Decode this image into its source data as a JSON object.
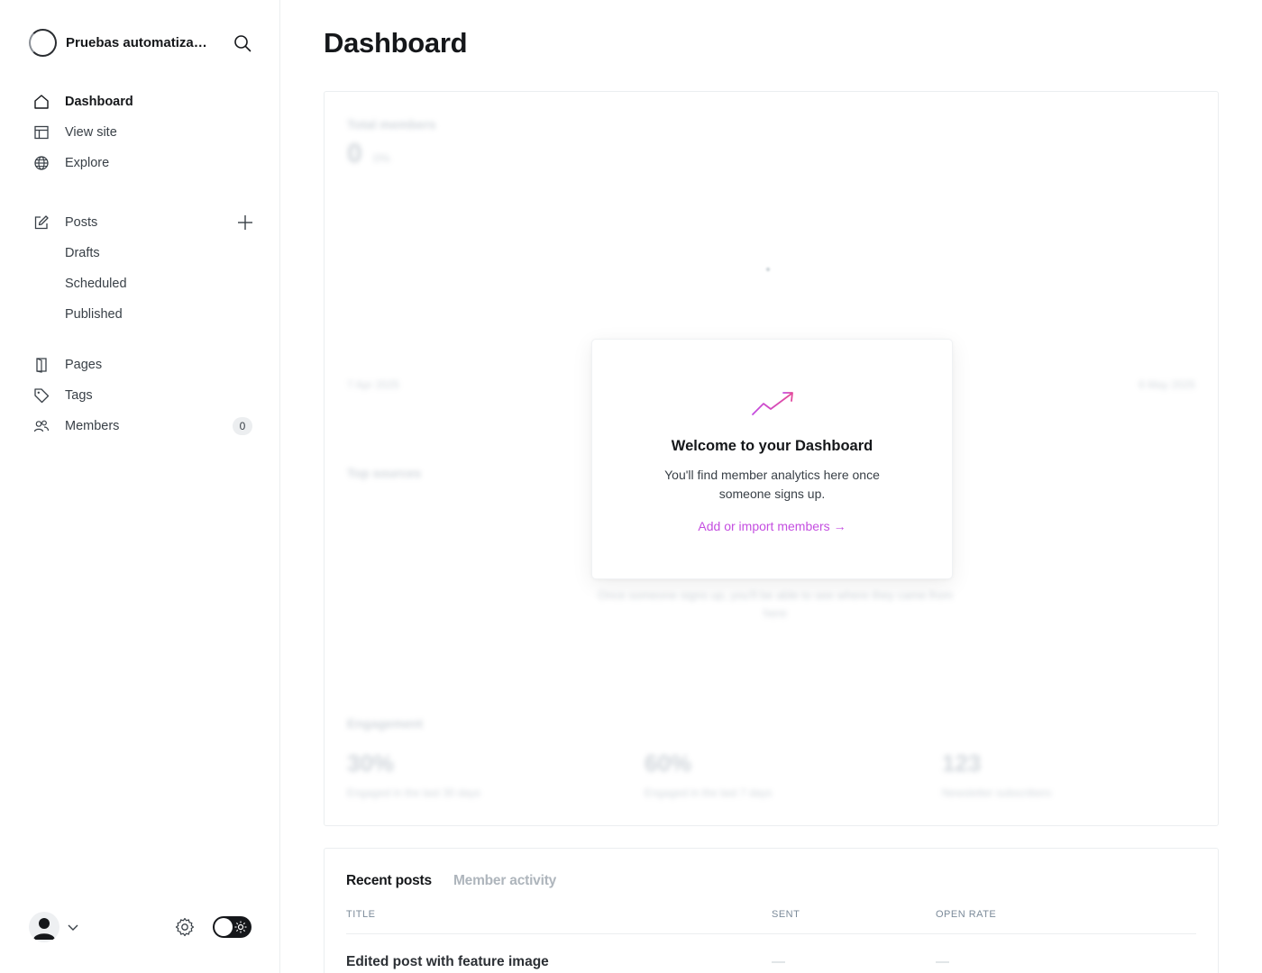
{
  "site": {
    "name": "Pruebas automatizadas"
  },
  "nav": {
    "dashboard": "Dashboard",
    "view_site": "View site",
    "explore": "Explore",
    "posts": "Posts",
    "drafts": "Drafts",
    "scheduled": "Scheduled",
    "published": "Published",
    "pages": "Pages",
    "tags": "Tags",
    "members": "Members",
    "members_count": "0"
  },
  "page": {
    "title": "Dashboard"
  },
  "blurred": {
    "total_members_label": "Total members",
    "total_members_value": "0",
    "total_members_pct": "0%",
    "date_start": "7 Apr 2025",
    "date_end": "6 May 2025",
    "top_sources_label": "Top sources",
    "sources_note": "Once someone signs up, you'll be able to see where they came from here",
    "engagement_label": "Engagement",
    "metrics": [
      {
        "value": "30%",
        "label": "Engaged in the last 30 days"
      },
      {
        "value": "60%",
        "label": "Engaged in the last 7 days"
      },
      {
        "value": "123",
        "label": "Newsletter subscribers"
      }
    ]
  },
  "welcome": {
    "title": "Welcome to your Dashboard",
    "text": "You'll find member analytics here once someone signs up.",
    "link": "Add or import members →"
  },
  "recent": {
    "tabs": [
      "Recent posts",
      "Member activity"
    ],
    "columns": {
      "title": "TITLE",
      "sent": "SENT",
      "open_rate": "OPEN RATE"
    },
    "rows": [
      {
        "title": "Edited post with feature image",
        "sent": "—",
        "open_rate": "—"
      }
    ]
  },
  "colors": {
    "accent": "#c44ee0",
    "text": "#15171a"
  },
  "icons": [
    "search-icon",
    "home-icon",
    "layout-icon",
    "globe-icon",
    "edit-icon",
    "plus-icon",
    "page-icon",
    "tag-icon",
    "members-icon",
    "gear-icon",
    "sun-icon",
    "trend-up-icon",
    "chevron-down-icon"
  ]
}
